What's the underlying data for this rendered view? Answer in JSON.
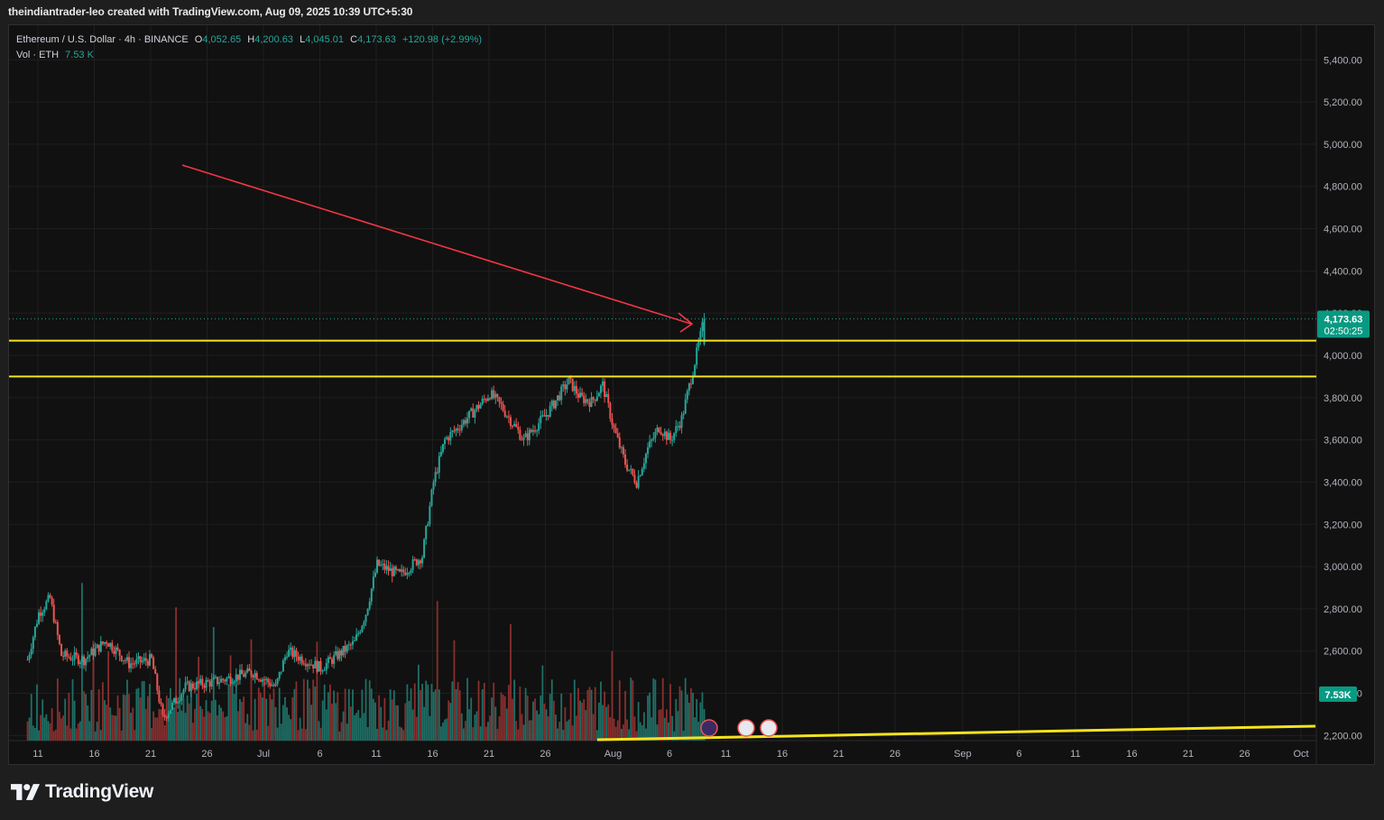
{
  "caption": "theindiantrader-leo created with TradingView.com, Aug 09, 2025 10:39 UTC+5:30",
  "legend": {
    "symbol": "Ethereum / U.S. Dollar · 4h · BINANCE",
    "o_label": "O",
    "o_value": "4,052.65",
    "h_label": "H",
    "h_value": "4,200.63",
    "l_label": "L",
    "l_value": "4,045.01",
    "c_label": "C",
    "c_value": "4,173.63",
    "change": "+120.98 (+2.99%)",
    "vol_label": "Vol · ETH",
    "vol_value": "7.53 K"
  },
  "price_tag": {
    "price": "4,173.63",
    "countdown": "02:50:25"
  },
  "vol_tag": "7.53K",
  "footer_brand": "TradingView",
  "colors": {
    "up": "#26a69a",
    "down": "#ef5350",
    "level": "#f5e31f",
    "arrow": "#f23645",
    "grid": "#1f1f1f",
    "background": "#111111"
  },
  "chart_data": {
    "type": "candlestick",
    "symbol": "ETHUSD",
    "timeframe": "4h",
    "y_ticks": [
      "5,400.00",
      "5,200.00",
      "5,000.00",
      "4,800.00",
      "4,600.00",
      "4,400.00",
      "4,200.00",
      "4,000.00",
      "3,800.00",
      "3,600.00",
      "3,400.00",
      "3,200.00",
      "3,000.00",
      "2,800.00",
      "2,600.00",
      "2,400.00",
      "2,200.00"
    ],
    "x_ticks": [
      "11",
      "16",
      "21",
      "26",
      "Jul",
      "6",
      "11",
      "16",
      "21",
      "26",
      "Aug",
      "6",
      "11",
      "16",
      "21",
      "26",
      "Sep",
      "6",
      "11",
      "16",
      "21",
      "26",
      "Oct"
    ],
    "horizontal_levels": [
      4070,
      3900
    ],
    "close_anchors": [
      {
        "date": "2025-06-10",
        "close": 2560
      },
      {
        "date": "2025-06-11",
        "close": 2780
      },
      {
        "date": "2025-06-12",
        "close": 2850
      },
      {
        "date": "2025-06-13",
        "close": 2580
      },
      {
        "date": "2025-06-15",
        "close": 2560
      },
      {
        "date": "2025-06-17",
        "close": 2650
      },
      {
        "date": "2025-06-19",
        "close": 2540
      },
      {
        "date": "2025-06-21",
        "close": 2560
      },
      {
        "date": "2025-06-22",
        "close": 2280
      },
      {
        "date": "2025-06-24",
        "close": 2430
      },
      {
        "date": "2025-06-27",
        "close": 2460
      },
      {
        "date": "2025-06-30",
        "close": 2500
      },
      {
        "date": "2025-07-02",
        "close": 2430
      },
      {
        "date": "2025-07-03",
        "close": 2600
      },
      {
        "date": "2025-07-06",
        "close": 2520
      },
      {
        "date": "2025-07-09",
        "close": 2640
      },
      {
        "date": "2025-07-10",
        "close": 2780
      },
      {
        "date": "2025-07-11",
        "close": 3010
      },
      {
        "date": "2025-07-13",
        "close": 2960
      },
      {
        "date": "2025-07-15",
        "close": 3050
      },
      {
        "date": "2025-07-16",
        "close": 3400
      },
      {
        "date": "2025-07-17",
        "close": 3600
      },
      {
        "date": "2025-07-18",
        "close": 3650
      },
      {
        "date": "2025-07-20",
        "close": 3760
      },
      {
        "date": "2025-07-21",
        "close": 3820
      },
      {
        "date": "2025-07-22",
        "close": 3760
      },
      {
        "date": "2025-07-24",
        "close": 3600
      },
      {
        "date": "2025-07-26",
        "close": 3720
      },
      {
        "date": "2025-07-28",
        "close": 3880
      },
      {
        "date": "2025-07-29",
        "close": 3800
      },
      {
        "date": "2025-07-30",
        "close": 3780
      },
      {
        "date": "2025-07-31",
        "close": 3860
      },
      {
        "date": "2025-08-01",
        "close": 3650
      },
      {
        "date": "2025-08-02",
        "close": 3490
      },
      {
        "date": "2025-08-03",
        "close": 3400
      },
      {
        "date": "2025-08-04",
        "close": 3560
      },
      {
        "date": "2025-08-05",
        "close": 3660
      },
      {
        "date": "2025-08-06",
        "close": 3600
      },
      {
        "date": "2025-08-07",
        "close": 3700
      },
      {
        "date": "2025-08-08",
        "close": 3930
      },
      {
        "date": "2025-08-09",
        "close": 4173.63
      }
    ]
  }
}
